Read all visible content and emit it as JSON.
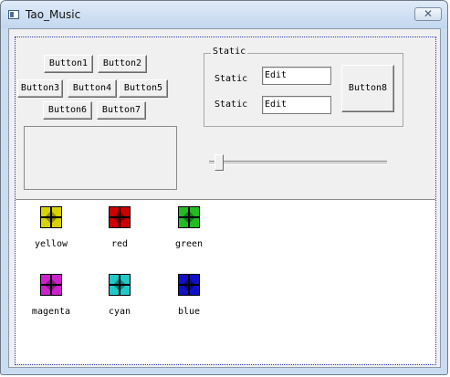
{
  "window": {
    "title": "Tao_Music",
    "close_symbol": "✕"
  },
  "buttons": [
    "Button1",
    "Button2",
    "Button3",
    "Button4",
    "Button5",
    "Button6",
    "Button7",
    "Button8"
  ],
  "group": {
    "title": "Static",
    "rows": [
      {
        "label": "Static",
        "value": "Edit"
      },
      {
        "label": "Static",
        "value": "Edit"
      }
    ]
  },
  "slider": {
    "position": 0.03
  },
  "icons": [
    {
      "name": "yellow",
      "color": "#d8d200"
    },
    {
      "name": "red",
      "color": "#cc0000"
    },
    {
      "name": "green",
      "color": "#22bb22"
    },
    {
      "name": "magenta",
      "color": "#cc22cc"
    },
    {
      "name": "cyan",
      "color": "#22c8c8"
    },
    {
      "name": "blue",
      "color": "#1010c8"
    }
  ]
}
